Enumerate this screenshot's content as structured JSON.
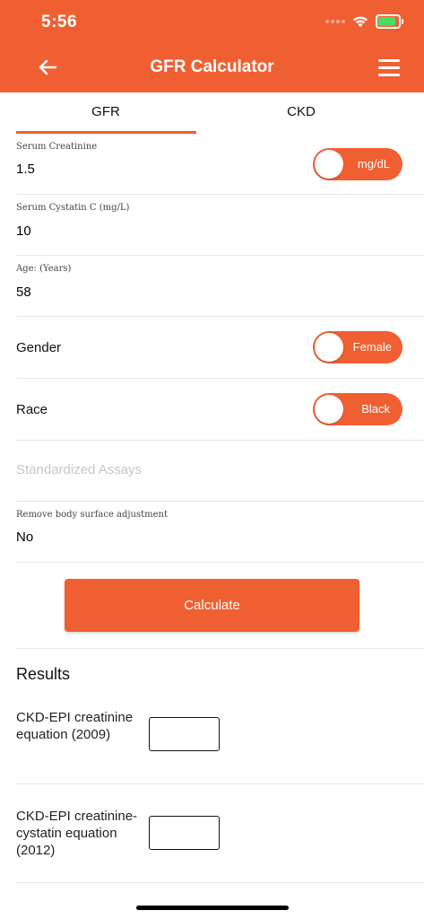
{
  "status_bar": {
    "time": "5:56"
  },
  "header": {
    "title": "GFR Calculator",
    "back_icon": "arrow-left-icon",
    "menu_icon": "hamburger-menu-icon"
  },
  "tabs": [
    {
      "label": "GFR",
      "active": true
    },
    {
      "label": "CKD",
      "active": false
    }
  ],
  "form": {
    "serum_creatinine": {
      "label": "Serum Creatinine",
      "value": "1.5",
      "unit_toggle": "mg/dL"
    },
    "serum_cystatin": {
      "label": "Serum Cystatin C (mg/L)",
      "value": "10"
    },
    "age": {
      "label": "Age: (Years)",
      "value": "58"
    },
    "gender": {
      "label": "Gender",
      "toggle": "Female"
    },
    "race": {
      "label": "Race",
      "toggle": "Black"
    },
    "standardized_assays": {
      "placeholder": "Standardized Assays"
    },
    "remove_bsa": {
      "label": "Remove body surface adjustment",
      "value": "No"
    }
  },
  "calculate_label": "Calculate",
  "results": {
    "title": "Results",
    "items": [
      {
        "label": "CKD-EPI creatinine equation (2009)",
        "value": ""
      },
      {
        "label": "CKD-EPI creatinine-cystatin equation (2012)",
        "value": ""
      }
    ]
  },
  "colors": {
    "accent": "#f05f32",
    "battery": "#4cd964"
  }
}
